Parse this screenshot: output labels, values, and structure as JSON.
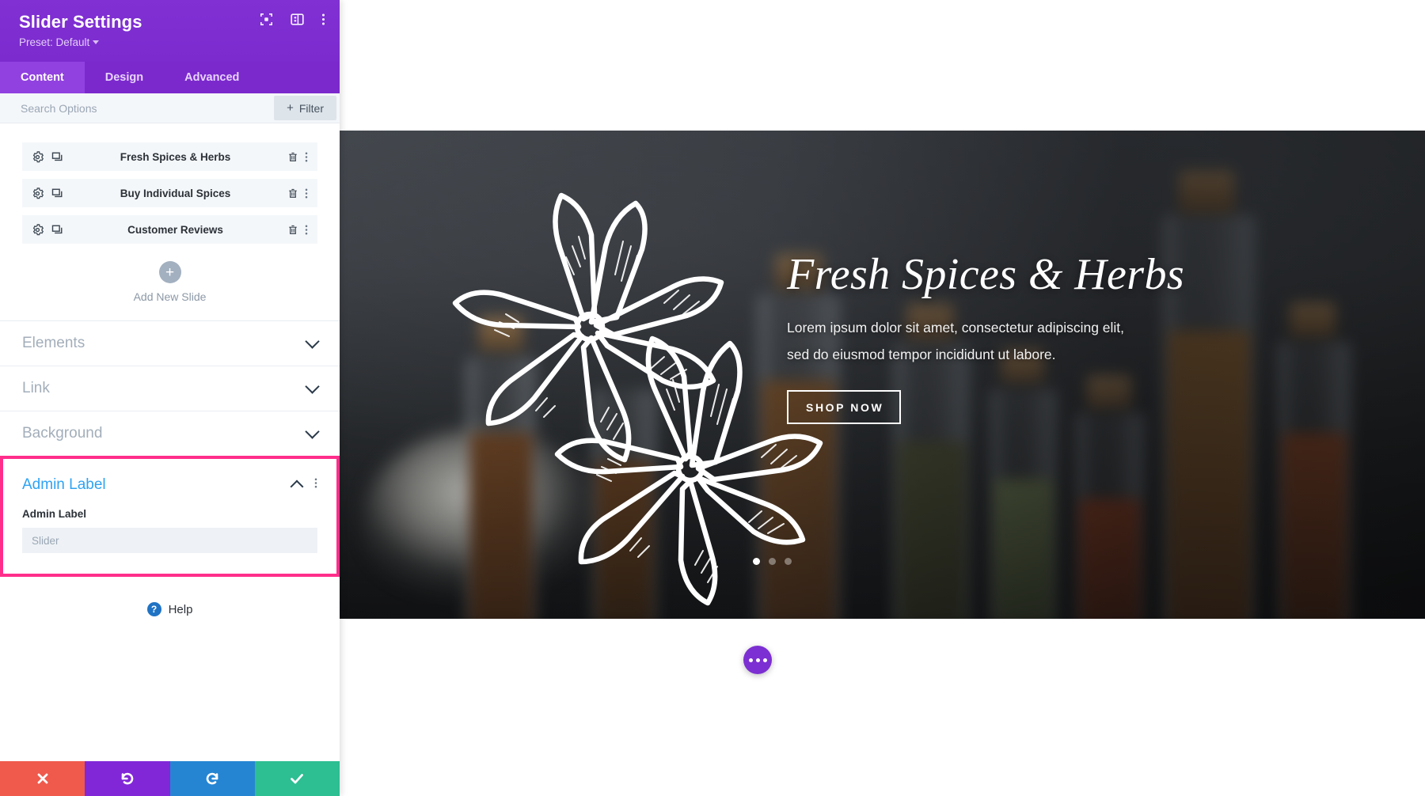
{
  "panel": {
    "title": "Slider Settings",
    "preset_label": "Preset: Default",
    "header_icons": [
      {
        "name": "fullscreen-icon",
        "glyph": "fullscreen"
      },
      {
        "name": "layout-panel-icon",
        "glyph": "layout"
      },
      {
        "name": "more-options-icon",
        "glyph": "kebab"
      }
    ],
    "tabs": [
      {
        "label": "Content",
        "active": true
      },
      {
        "label": "Design",
        "active": false
      },
      {
        "label": "Advanced",
        "active": false
      }
    ],
    "search": {
      "placeholder": "Search Options",
      "value": ""
    },
    "filter_button": {
      "label": "Filter",
      "plus": "+"
    },
    "slides": [
      {
        "name": "Fresh Spices & Herbs"
      },
      {
        "name": "Buy Individual Spices"
      },
      {
        "name": "Customer Reviews"
      }
    ],
    "add_slide": {
      "plus": "+",
      "label": "Add New Slide"
    },
    "sections": [
      {
        "title": "Elements",
        "open": false
      },
      {
        "title": "Link",
        "open": false
      },
      {
        "title": "Background",
        "open": false
      }
    ],
    "open_section": {
      "title": "Admin Label",
      "field_label": "Admin Label",
      "field_placeholder": "Slider",
      "field_value": "",
      "highlight_color": "#ff2e8b"
    },
    "help": {
      "icon_glyph": "?",
      "label": "Help"
    },
    "actions": [
      {
        "name": "cancel",
        "glyph": "✕",
        "color": "#ef5a4c"
      },
      {
        "name": "undo",
        "glyph": "↺",
        "color": "#8127d8"
      },
      {
        "name": "redo",
        "glyph": "↻",
        "color": "#2585d3"
      },
      {
        "name": "save",
        "glyph": "✓",
        "color": "#2dbe92"
      }
    ],
    "colors": {
      "header": "#7f2dd1",
      "tab_active": "#9141e0",
      "accent_blue": "#2ea3f2"
    }
  },
  "preview": {
    "slide": {
      "title": "Fresh Spices & Herbs",
      "body_line1": "Lorem ipsum dolor sit amet, consectetur adipiscing elit,",
      "body_line2": "sed do eiusmod tempor incididunt ut labore.",
      "button_label": "SHOP NOW"
    },
    "pagination": {
      "count": 3,
      "active_index": 0
    },
    "fab": {
      "name": "page-settings-fab"
    }
  }
}
